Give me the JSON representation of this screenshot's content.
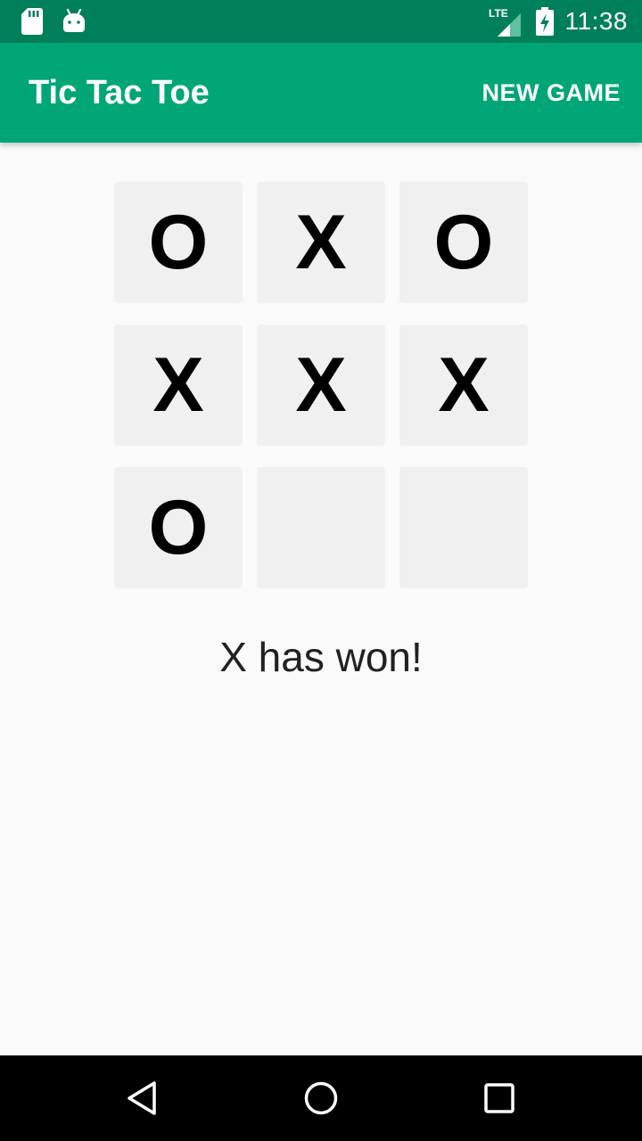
{
  "status_bar": {
    "time": "11:38",
    "network_label": "LTE",
    "icons": [
      "sd-card-icon",
      "android-icon",
      "lte-signal-icon",
      "battery-charging-icon"
    ]
  },
  "app_bar": {
    "title": "Tic Tac Toe",
    "action_label": "NEW GAME",
    "color": "#00a676",
    "status_color": "#00805a"
  },
  "board": {
    "cells": [
      "O",
      "X",
      "O",
      "X",
      "X",
      "X",
      "O",
      "",
      ""
    ]
  },
  "result": {
    "message": "X has won!"
  },
  "nav_bar": {
    "buttons": [
      "back-icon",
      "home-icon",
      "recents-icon"
    ]
  }
}
